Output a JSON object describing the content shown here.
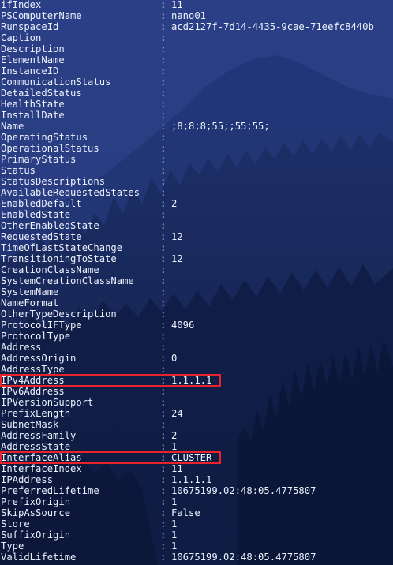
{
  "colors": {
    "terminal_text": "#eef2ff",
    "highlight_border": "#e8232a",
    "background_tint": "#1c2c63"
  },
  "properties": [
    {
      "name": "ifIndex",
      "value": "11"
    },
    {
      "name": "PSComputerName",
      "value": "nano01"
    },
    {
      "name": "RunspaceId",
      "value": "acd2127f-7d14-4435-9cae-71eefc8440b"
    },
    {
      "name": "Caption",
      "value": ""
    },
    {
      "name": "Description",
      "value": ""
    },
    {
      "name": "ElementName",
      "value": ""
    },
    {
      "name": "InstanceID",
      "value": ""
    },
    {
      "name": "CommunicationStatus",
      "value": ""
    },
    {
      "name": "DetailedStatus",
      "value": ""
    },
    {
      "name": "HealthState",
      "value": ""
    },
    {
      "name": "InstallDate",
      "value": ""
    },
    {
      "name": "Name",
      "value": ";8;8;8;55;;55;55;"
    },
    {
      "name": "OperatingStatus",
      "value": ""
    },
    {
      "name": "OperationalStatus",
      "value": ""
    },
    {
      "name": "PrimaryStatus",
      "value": ""
    },
    {
      "name": "Status",
      "value": ""
    },
    {
      "name": "StatusDescriptions",
      "value": ""
    },
    {
      "name": "AvailableRequestedStates",
      "value": ""
    },
    {
      "name": "EnabledDefault",
      "value": "2"
    },
    {
      "name": "EnabledState",
      "value": ""
    },
    {
      "name": "OtherEnabledState",
      "value": ""
    },
    {
      "name": "RequestedState",
      "value": "12"
    },
    {
      "name": "TimeOfLastStateChange",
      "value": ""
    },
    {
      "name": "TransitioningToState",
      "value": "12"
    },
    {
      "name": "CreationClassName",
      "value": ""
    },
    {
      "name": "SystemCreationClassName",
      "value": ""
    },
    {
      "name": "SystemName",
      "value": ""
    },
    {
      "name": "NameFormat",
      "value": ""
    },
    {
      "name": "OtherTypeDescription",
      "value": ""
    },
    {
      "name": "ProtocolIFType",
      "value": "4096"
    },
    {
      "name": "ProtocolType",
      "value": ""
    },
    {
      "name": "Address",
      "value": ""
    },
    {
      "name": "AddressOrigin",
      "value": "0"
    },
    {
      "name": "AddressType",
      "value": ""
    },
    {
      "name": "IPv4Address",
      "value": "1.1.1.1",
      "highlighted": true
    },
    {
      "name": "IPv6Address",
      "value": ""
    },
    {
      "name": "IPVersionSupport",
      "value": ""
    },
    {
      "name": "PrefixLength",
      "value": "24"
    },
    {
      "name": "SubnetMask",
      "value": ""
    },
    {
      "name": "AddressFamily",
      "value": "2"
    },
    {
      "name": "AddressState",
      "value": "1"
    },
    {
      "name": "InterfaceAlias",
      "value": "CLUSTER",
      "highlighted": true
    },
    {
      "name": "InterfaceIndex",
      "value": "11"
    },
    {
      "name": "IPAddress",
      "value": "1.1.1.1"
    },
    {
      "name": "PreferredLifetime",
      "value": "10675199.02:48:05.4775807"
    },
    {
      "name": "PrefixOrigin",
      "value": "1"
    },
    {
      "name": "SkipAsSource",
      "value": "False"
    },
    {
      "name": "Store",
      "value": "1"
    },
    {
      "name": "SuffixOrigin",
      "value": "1"
    },
    {
      "name": "Type",
      "value": "1"
    },
    {
      "name": "ValidLifetime",
      "value": "10675199.02:48:05.4775807"
    }
  ],
  "separator": ":"
}
